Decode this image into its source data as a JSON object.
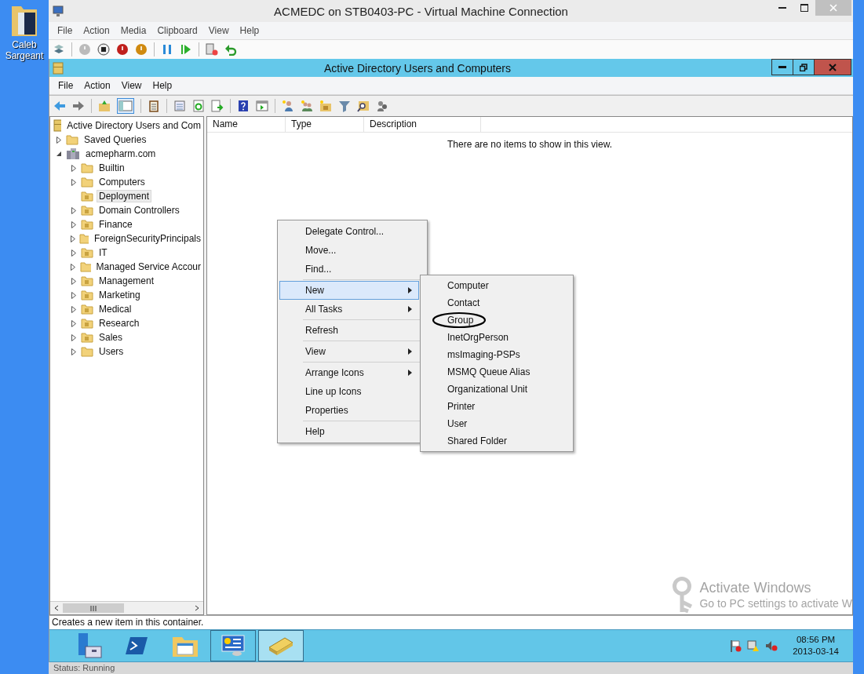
{
  "desktop": {
    "icon_label": "Caleb Sargeant"
  },
  "vm_window": {
    "title": "ACMEDC on STB0403-PC - Virtual Machine Connection",
    "menu": [
      "File",
      "Action",
      "Media",
      "Clipboard",
      "View",
      "Help"
    ],
    "status": "Status: Running"
  },
  "aduc": {
    "title": "Active Directory Users and Computers",
    "menu": [
      "File",
      "Action",
      "View",
      "Help"
    ],
    "tree": {
      "label": "Active Directory Users and Com",
      "children": [
        {
          "label": "Saved Queries",
          "kind": "folder",
          "expanded": false,
          "selected": false
        },
        {
          "label": "acmepharm.com",
          "kind": "domain",
          "expanded": true,
          "selected": false,
          "children": [
            {
              "label": "Builtin",
              "kind": "folder",
              "expanded": false,
              "selected": false
            },
            {
              "label": "Computers",
              "kind": "folder",
              "expanded": false,
              "selected": false
            },
            {
              "label": "Deployment",
              "kind": "ou",
              "selected": true
            },
            {
              "label": "Domain Controllers",
              "kind": "ou",
              "expanded": false,
              "selected": false
            },
            {
              "label": "Finance",
              "kind": "ou",
              "expanded": false,
              "selected": false
            },
            {
              "label": "ForeignSecurityPrincipals",
              "kind": "folder",
              "expanded": false,
              "selected": false
            },
            {
              "label": "IT",
              "kind": "ou",
              "expanded": false,
              "selected": false
            },
            {
              "label": "Managed Service Accour",
              "kind": "folder",
              "expanded": false,
              "selected": false
            },
            {
              "label": "Management",
              "kind": "ou",
              "expanded": false,
              "selected": false
            },
            {
              "label": "Marketing",
              "kind": "ou",
              "expanded": false,
              "selected": false
            },
            {
              "label": "Medical",
              "kind": "ou",
              "expanded": false,
              "selected": false
            },
            {
              "label": "Research",
              "kind": "ou",
              "expanded": false,
              "selected": false
            },
            {
              "label": "Sales",
              "kind": "ou",
              "expanded": false,
              "selected": false
            },
            {
              "label": "Users",
              "kind": "folder",
              "expanded": false,
              "selected": false
            }
          ]
        }
      ]
    },
    "columns": [
      "Name",
      "Type",
      "Description"
    ],
    "empty_message": "There are no items to show in this view.",
    "context_menu": [
      {
        "kind": "item",
        "label": "Delegate Control...",
        "selected": false
      },
      {
        "kind": "item",
        "label": "Move...",
        "selected": false
      },
      {
        "kind": "item",
        "label": "Find...",
        "selected": false
      },
      {
        "kind": "separator"
      },
      {
        "kind": "submenu",
        "label": "New",
        "selected": true
      },
      {
        "kind": "submenu",
        "label": "All Tasks",
        "selected": false
      },
      {
        "kind": "separator"
      },
      {
        "kind": "item",
        "label": "Refresh",
        "selected": false
      },
      {
        "kind": "separator"
      },
      {
        "kind": "submenu",
        "label": "View",
        "selected": false
      },
      {
        "kind": "separator"
      },
      {
        "kind": "submenu",
        "label": "Arrange Icons",
        "selected": false
      },
      {
        "kind": "item",
        "label": "Line up Icons",
        "selected": false
      },
      {
        "kind": "item",
        "label": "Properties",
        "selected": false
      },
      {
        "kind": "separator"
      },
      {
        "kind": "item",
        "label": "Help",
        "selected": false
      }
    ],
    "submenu": [
      {
        "label": "Computer",
        "circled": false
      },
      {
        "label": "Contact",
        "circled": false
      },
      {
        "label": "Group",
        "circled": true
      },
      {
        "label": "InetOrgPerson",
        "circled": false
      },
      {
        "label": "msImaging-PSPs",
        "circled": false
      },
      {
        "label": "MSMQ Queue Alias",
        "circled": false
      },
      {
        "label": "Organizational Unit",
        "circled": false
      },
      {
        "label": "Printer",
        "circled": false
      },
      {
        "label": "User",
        "circled": false
      },
      {
        "label": "Shared Folder",
        "circled": false
      }
    ],
    "status_text": "Creates a new item in this container.",
    "taskbar": {
      "apps": [
        {
          "kind": "server",
          "open": false,
          "selected": false
        },
        {
          "kind": "terminal",
          "open": false,
          "selected": false
        },
        {
          "kind": "folder",
          "open": false,
          "selected": false
        },
        {
          "kind": "panel",
          "open": true,
          "selected": false
        },
        {
          "kind": "book",
          "open": true,
          "selected": true
        }
      ],
      "time": "08:56 PM",
      "date": "2013-03-14"
    },
    "activation_notice": [
      "Activate Windows",
      "Go to PC settings to activate W"
    ]
  }
}
